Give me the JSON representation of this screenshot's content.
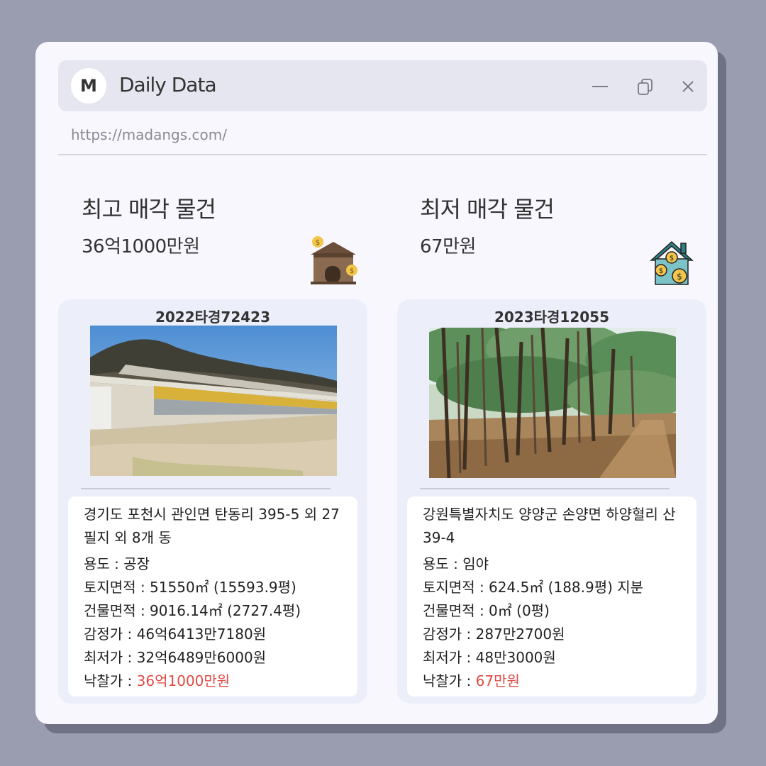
{
  "window": {
    "avatar_letter": "M",
    "title": "Daily Data",
    "url": "https://madangs.com/"
  },
  "highest": {
    "heading": "최고 매각 물건",
    "price": "36억1000만원",
    "icon": "house-coins-icon",
    "case_no": "2022타경72423",
    "photo": "factory-building-photo",
    "address": "경기도 포천시 관인면 탄동리 395-5 외 27 필지 외 8개 동",
    "usage": "용도 : 공장",
    "land_area": "토지면적 : 51550㎡ (15593.9평)",
    "building_area": "건물면적 : 9016.14㎡ (2727.4평)",
    "appraisal": "감정가 : 46억6413만7180원",
    "minimum": "최저가 : 32억6489만6000원",
    "winning_label": "낙찰가 : ",
    "winning_value": "36억1000만원"
  },
  "lowest": {
    "heading": "최저 매각 물건",
    "price": "67만원",
    "icon": "house-dollar-icon",
    "case_no": "2023타경12055",
    "photo": "pine-forest-photo",
    "address": "강원특별자치도 양양군 손양면 하양혈리 산39-4",
    "usage": "용도 : 임야",
    "land_area": "토지면적 : 624.5㎡ (188.9평) 지분",
    "building_area": "건물면적 : 0㎡ (0평)",
    "appraisal": "감정가 :  287만2700원",
    "minimum": "최저가 : 48만3000원",
    "winning_label": "낙찰가 : ",
    "winning_value": "67만원"
  },
  "colors": {
    "accent_red": "#e24b46",
    "background": "#9a9caf",
    "window": "#f7f7fd",
    "card": "#eceef9"
  }
}
